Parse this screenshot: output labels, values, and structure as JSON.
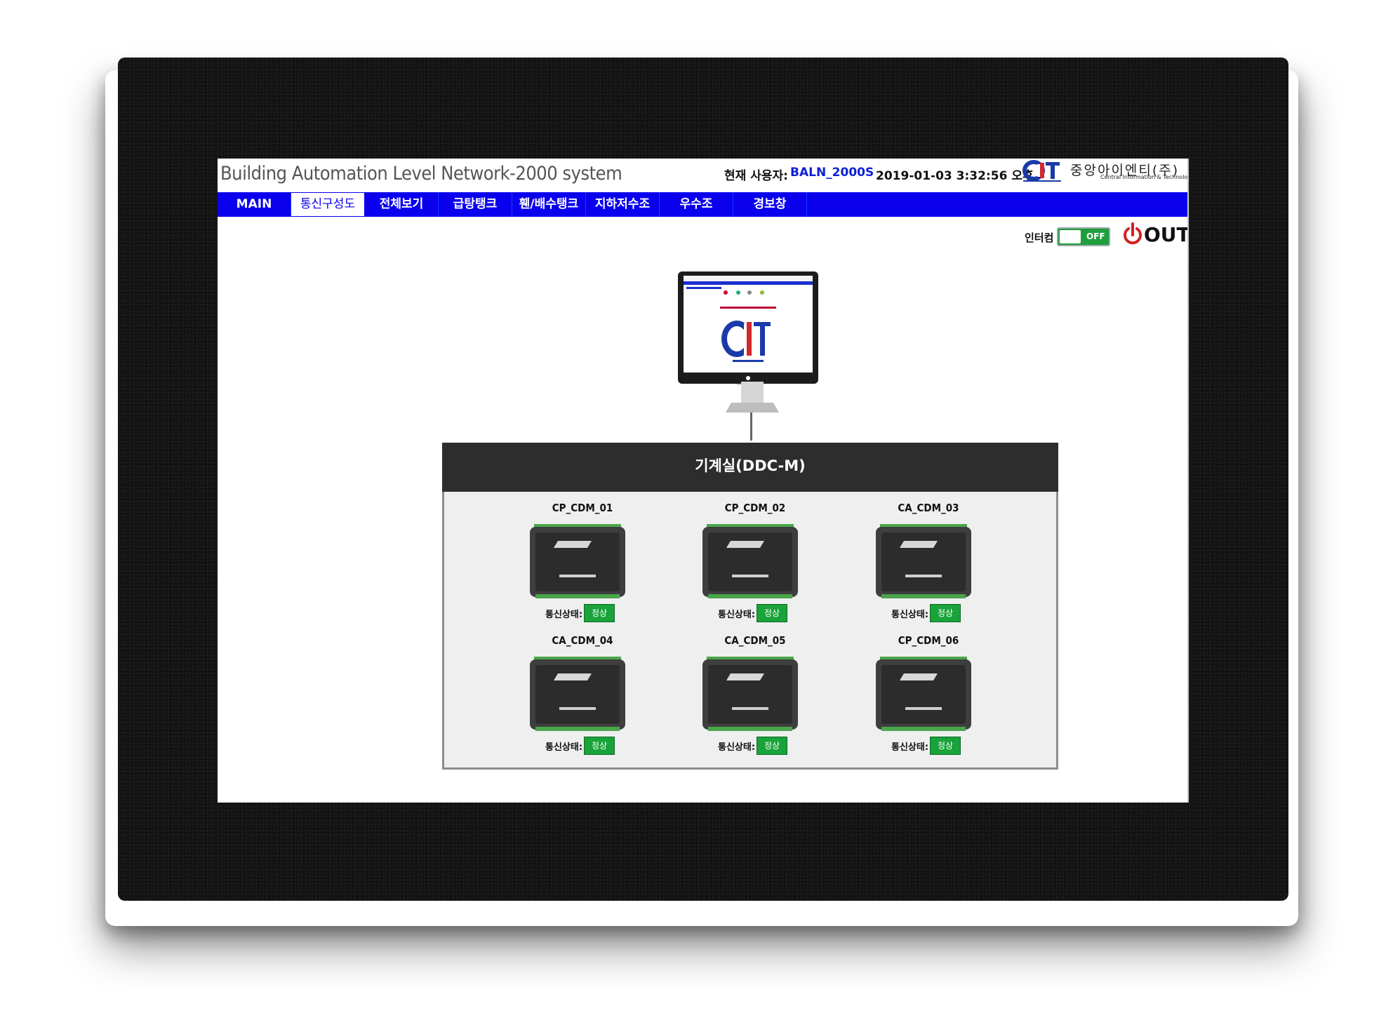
{
  "header": {
    "title": "Building Automation Level Network-2000 system",
    "current_user_label": "현재 사용자:",
    "current_user": "BALN_2000S",
    "datetime": "2019-01-03   3:32:56 오후",
    "company_name": "중앙아이엔티(주)",
    "company_sub": "Central Information & Technology Co.,LTD"
  },
  "nav": {
    "tabs": [
      {
        "label": "MAIN"
      },
      {
        "label": "통신구성도"
      },
      {
        "label": "전체보기"
      },
      {
        "label": "급탕탱크"
      },
      {
        "label": "휀/배수탱크"
      },
      {
        "label": "지하저수조"
      },
      {
        "label": "우수조"
      },
      {
        "label": "경보창"
      }
    ],
    "active_index": 1
  },
  "controls": {
    "intercom_label": "인터컴",
    "intercom_state": "OFF",
    "logout_label": "OUT"
  },
  "panel": {
    "title": "기계실(DDC-M)",
    "devices": [
      {
        "name": "CP_CDM_01",
        "status_label": "통신상태:",
        "status": "정상"
      },
      {
        "name": "CP_CDM_02",
        "status_label": "통신상태:",
        "status": "정상"
      },
      {
        "name": "CA_CDM_03",
        "status_label": "통신상태:",
        "status": "정상"
      },
      {
        "name": "CA_CDM_04",
        "status_label": "통신상태:",
        "status": "정상"
      },
      {
        "name": "CA_CDM_05",
        "status_label": "통신상태:",
        "status": "정상"
      },
      {
        "name": "CP_CDM_06",
        "status_label": "통신상태:",
        "status": "정상"
      }
    ]
  },
  "colors": {
    "nav_bg": "#0a00ee",
    "status_ok": "#19a33a",
    "bezel": "#141414"
  }
}
